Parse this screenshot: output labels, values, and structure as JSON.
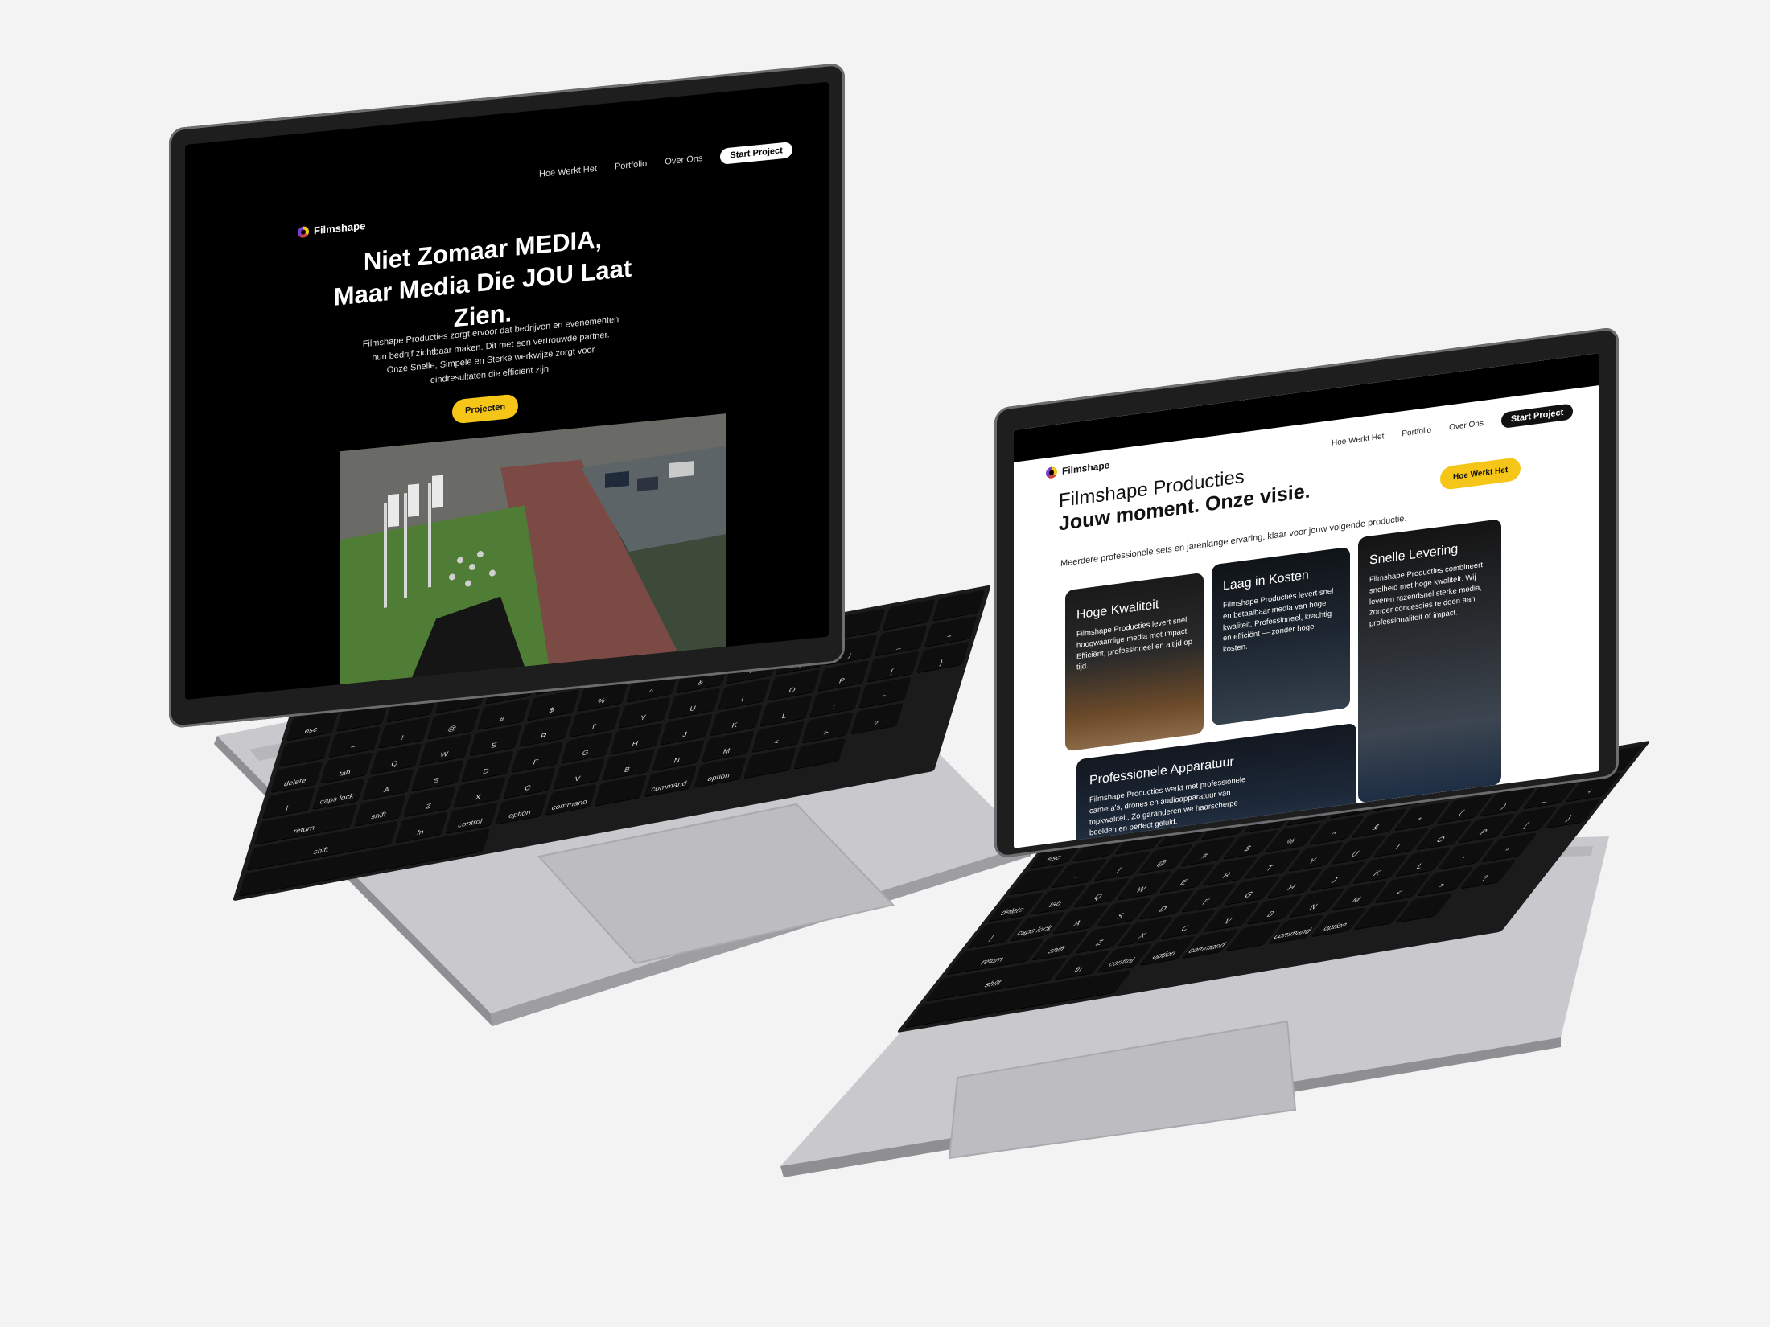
{
  "site": {
    "brand": "Filmshape",
    "nav": [
      "Hoe Werkt Het",
      "Portfolio",
      "Over Ons"
    ],
    "nav_cta": "Start Project"
  },
  "laptop1": {
    "hero_line1": "Niet Zomaar MEDIA,",
    "hero_line2": "Maar Media Die JOU Laat Zien.",
    "hero_text": "Filmshape Producties zorgt ervoor dat bedrijven en evenementen hun bedrijf zichtbaar maken. Dit met een vertrouwde partner. Onze Snelle, Simpele en Sterke werkwijze zorgt voor eindresultaten die efficiënt zijn.",
    "hero_button": "Projecten"
  },
  "laptop2": {
    "heading_light": "Filmshape Producties",
    "heading_bold": "Jouw moment. Onze visie.",
    "cta_button": "Hoe Werkt Het",
    "subtext": "Meerdere professionele sets en jarenlange ervaring, klaar voor jouw volgende productie.",
    "cards": [
      {
        "title": "Hoge Kwaliteit",
        "text": "Filmshape Producties levert snel hoogwaardige media met impact. Efficiënt, professioneel en altijd op tijd."
      },
      {
        "title": "Laag in Kosten",
        "text": "Filmshape Producties levert snel en betaalbaar media van hoge kwaliteit. Professioneel, krachtig en efficiënt — zonder hoge kosten."
      },
      {
        "title": "Snelle Levering",
        "text": "Filmshape Producties combineert snelheid met hoge kwaliteit. Wij leveren razendsnel sterke media, zonder concessies te doen aan professionaliteit of impact."
      },
      {
        "title": "Professionele Apparatuur",
        "text": "Filmshape Producties werkt met professionele camera's, drones en audioapparatuur van topkwaliteit. Zo garanderen we haarscherpe beelden en perfect geluid."
      }
    ]
  },
  "keyboard": {
    "row1": [
      "esc",
      "",
      "",
      "",
      "",
      "",
      "",
      "",
      "",
      "",
      "",
      "",
      "",
      "",
      ""
    ],
    "row2": [
      "~",
      "!",
      "@",
      "#",
      "$",
      "%",
      "^",
      "&",
      "*",
      "(",
      ")",
      "_",
      "+",
      "delete"
    ],
    "row3": [
      "tab",
      "Q",
      "W",
      "E",
      "R",
      "T",
      "Y",
      "U",
      "I",
      "O",
      "P",
      "{",
      "}",
      "|"
    ],
    "row4": [
      "caps lock",
      "A",
      "S",
      "D",
      "F",
      "G",
      "H",
      "J",
      "K",
      "L",
      ":",
      "\"",
      "return"
    ],
    "row5": [
      "shift",
      "Z",
      "X",
      "C",
      "V",
      "B",
      "N",
      "M",
      "<",
      ">",
      "?",
      "shift"
    ],
    "row6": [
      "fn",
      "control",
      "option",
      "command",
      "",
      "command",
      "option",
      "",
      "",
      ""
    ]
  },
  "colors": {
    "accent": "#f5c518",
    "page_bg": "#f3f3f3",
    "aluminium": "#c6c6ca",
    "screen_dark": "#000000"
  }
}
